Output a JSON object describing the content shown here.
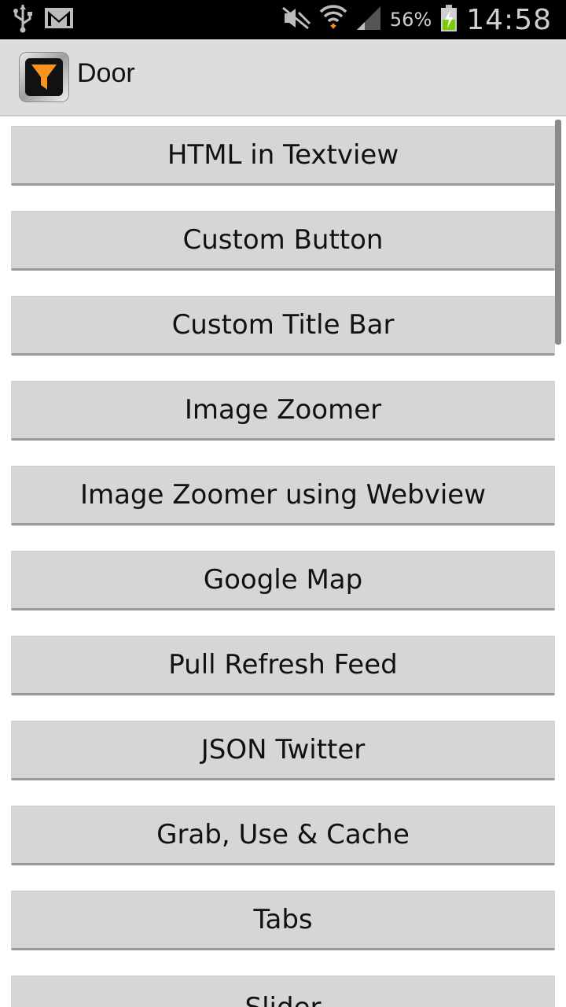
{
  "status_bar": {
    "battery_percent": "56%",
    "time": "14:58",
    "icons": [
      "usb-icon",
      "gmail-icon",
      "mute-icon",
      "wifi-icon",
      "signal-icon",
      "battery-charging-icon"
    ]
  },
  "app_bar": {
    "title": "Door",
    "icon": "funnel-icon",
    "icon_accent": "#f7931e"
  },
  "menu": {
    "items": [
      {
        "label": "HTML in Textview"
      },
      {
        "label": "Custom Button"
      },
      {
        "label": "Custom Title Bar"
      },
      {
        "label": "Image Zoomer"
      },
      {
        "label": "Image Zoomer using Webview"
      },
      {
        "label": "Google Map"
      },
      {
        "label": "Pull Refresh Feed"
      },
      {
        "label": "JSON Twitter"
      },
      {
        "label": "Grab, Use & Cache"
      },
      {
        "label": "Tabs"
      },
      {
        "label": "Slider"
      }
    ]
  },
  "colors": {
    "status_bar_bg": "#000000",
    "app_bar_bg": "#dddddd",
    "button_bg": "#d6d6d6"
  }
}
